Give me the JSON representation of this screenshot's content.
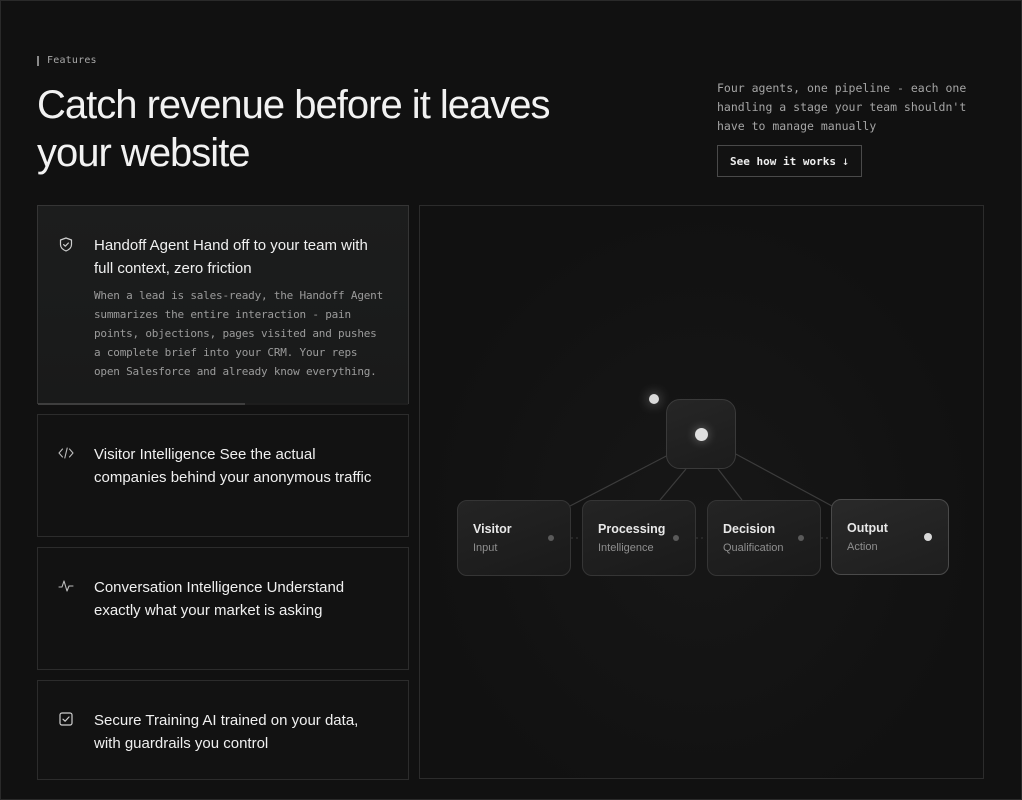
{
  "section": {
    "eyebrow": "Features",
    "headline": "Catch revenue before it leaves your website",
    "intro": "Four agents, one pipeline - each one handling a stage your team shouldn't have to manage manually",
    "cta_label": "See how it works",
    "cta_icon": "arrow-down-icon"
  },
  "cards": [
    {
      "title": "Handoff Agent Hand off to your team with full context, zero friction",
      "description": "When a lead is sales-ready, the Handoff Agent summarizes the entire interaction - pain points, objections, pages visited and pushes a complete brief into your CRM. Your reps open Salesforce and already know everything.",
      "icon": "shield-check-icon",
      "active": true,
      "progress": 0.56
    },
    {
      "title": "Visitor Intelligence See the actual companies behind your anonymous traffic",
      "icon": "code-icon"
    },
    {
      "title": "Conversation Intelligence Understand exactly what your market is asking",
      "icon": "waveform-icon"
    },
    {
      "title": "Secure Training AI trained on your data, with guardrails you control",
      "icon": "checkbox-icon"
    }
  ],
  "pipeline": {
    "nodes": [
      {
        "title": "Visitor",
        "subtitle": "Input"
      },
      {
        "title": "Processing",
        "subtitle": "Intelligence"
      },
      {
        "title": "Decision",
        "subtitle": "Qualification"
      },
      {
        "title": "Output",
        "subtitle": "Action"
      }
    ]
  },
  "colors": {
    "background": "#111111",
    "text": "#f2f2f2",
    "muted": "#9b9b9b",
    "border": "#2c2c2c"
  }
}
